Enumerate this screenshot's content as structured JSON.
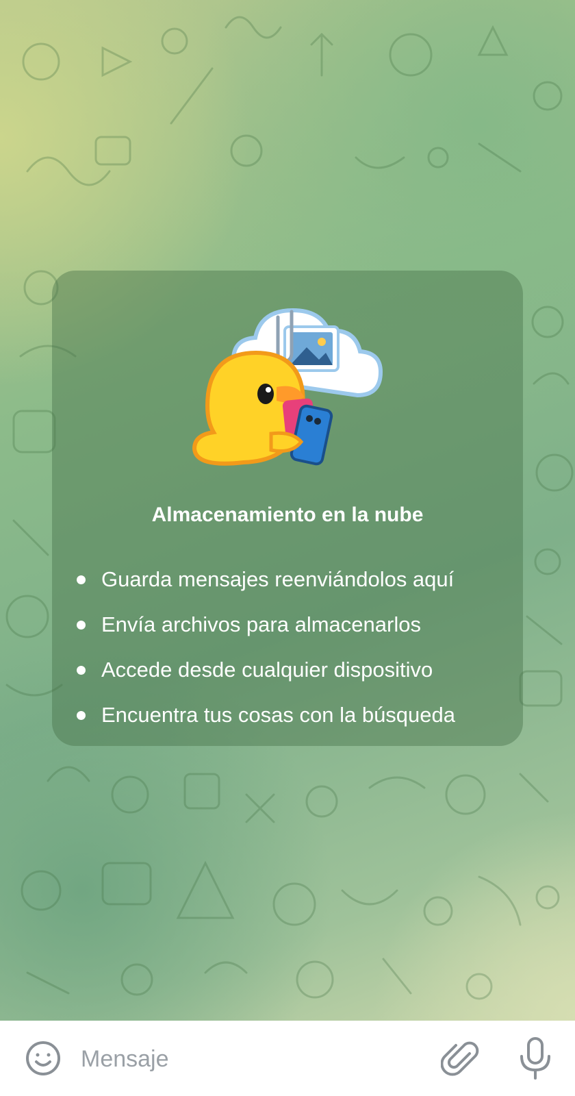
{
  "info_card": {
    "title": "Almacenamiento en la nube",
    "items": [
      "Guarda mensajes reenviándolos aquí",
      "Envía archivos para almacenarlos",
      "Accede desde cualquier dispositivo",
      "Encuentra tus cosas con la búsqueda"
    ]
  },
  "composer": {
    "placeholder": "Mensaje"
  },
  "colors": {
    "card_text": "#ffffff",
    "icon_gray": "#8a9096",
    "duck_yellow": "#ffd227",
    "cloud_blue": "#9cc9ec"
  },
  "icons": [
    "emoji-icon",
    "paperclip-icon",
    "microphone-icon"
  ]
}
